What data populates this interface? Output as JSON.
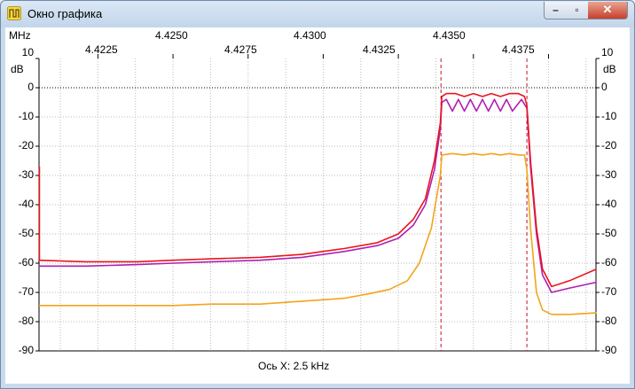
{
  "window": {
    "title": "Окно графика",
    "icon": "chart-icon",
    "controls": [
      "minimize-icon",
      "maximize-icon",
      "close-icon"
    ]
  },
  "chart_data": {
    "type": "line",
    "x_unit_label": "MHz",
    "y_unit_label": "dB",
    "footer": "Ось X: 2.5 kHz",
    "xlim": [
      4.42054,
      4.43908
    ],
    "ylim": [
      -90,
      10
    ],
    "x_ticks_top": [
      "4.4250",
      "4.4300",
      "4.4350"
    ],
    "x_ticks_bottom": [
      "4.4225",
      "4.4275",
      "4.4325",
      "4.4375"
    ],
    "y_ticks": [
      "10",
      "0",
      "-10",
      "-20",
      "-30",
      "-40",
      "-50",
      "-60",
      "-70",
      "-80",
      "-90"
    ],
    "grid": true,
    "markers": [
      4.43392,
      4.43678
    ],
    "colors": {
      "series1": "#e8151e",
      "series2": "#b01fb0",
      "series3": "#f3a41b",
      "markers": "#c8102e",
      "grid": "#bbbbbb"
    },
    "series": [
      {
        "color": "#e8151e",
        "x": [
          4.42054,
          4.4221,
          4.4238,
          4.425,
          4.4263,
          4.4279,
          4.4293,
          4.4307,
          4.4318,
          4.4325,
          4.433,
          4.4334,
          4.4337,
          4.4339,
          4.43395,
          4.4341,
          4.4344,
          4.4347,
          4.435,
          4.4353,
          4.4356,
          4.4359,
          4.4362,
          4.4365,
          4.4367,
          4.43678,
          4.4369,
          4.4371,
          4.4373,
          4.4376,
          4.4382,
          4.4391
        ],
        "y": [
          -59,
          -59.5,
          -59.5,
          -59,
          -58.5,
          -58,
          -57,
          -55,
          -53,
          -50,
          -45,
          -38,
          -25,
          -12,
          -3,
          -2,
          -2,
          -3,
          -2,
          -3,
          -2,
          -3,
          -2,
          -2,
          -3,
          -6,
          -25,
          -48,
          -62,
          -68,
          -66,
          -62
        ]
      },
      {
        "color": "#b01fb0",
        "x": [
          4.42054,
          4.4221,
          4.4238,
          4.425,
          4.4263,
          4.4279,
          4.4293,
          4.4307,
          4.4318,
          4.4325,
          4.433,
          4.4334,
          4.4337,
          4.4339,
          4.43395,
          4.4341,
          4.4343,
          4.4345,
          4.4347,
          4.4349,
          4.4351,
          4.4353,
          4.4355,
          4.4357,
          4.4359,
          4.4361,
          4.4363,
          4.4366,
          4.43678,
          4.4369,
          4.4371,
          4.4373,
          4.4376,
          4.4382,
          4.4391
        ],
        "y": [
          -61,
          -61,
          -60.5,
          -60,
          -59.5,
          -59,
          -58,
          -56,
          -54,
          -51.5,
          -47,
          -40,
          -28,
          -14,
          -5,
          -4,
          -8,
          -4,
          -8,
          -4,
          -8,
          -4,
          -8,
          -4,
          -8,
          -4,
          -8,
          -4,
          -7,
          -27,
          -50,
          -64,
          -70,
          -68.5,
          -66.5
        ]
      },
      {
        "color": "#f3a41b",
        "x": [
          4.42054,
          4.4221,
          4.4238,
          4.425,
          4.4263,
          4.4279,
          4.4293,
          4.4307,
          4.4315,
          4.4322,
          4.4328,
          4.4332,
          4.4336,
          4.4339,
          4.43395,
          4.4343,
          4.4347,
          4.435,
          4.4353,
          4.4356,
          4.4359,
          4.4362,
          4.4365,
          4.4367,
          4.43678,
          4.4369,
          4.4371,
          4.4373,
          4.4376,
          4.4382,
          4.4391
        ],
        "y": [
          -74.5,
          -74.5,
          -74.5,
          -74.5,
          -74,
          -74,
          -73,
          -72,
          -70.5,
          -69,
          -66,
          -60,
          -48,
          -30,
          -23,
          -22.5,
          -23,
          -22.5,
          -23,
          -22.5,
          -23,
          -22.5,
          -23,
          -23,
          -28,
          -48,
          -70,
          -76,
          -77.5,
          -77.5,
          -77
        ]
      }
    ]
  }
}
